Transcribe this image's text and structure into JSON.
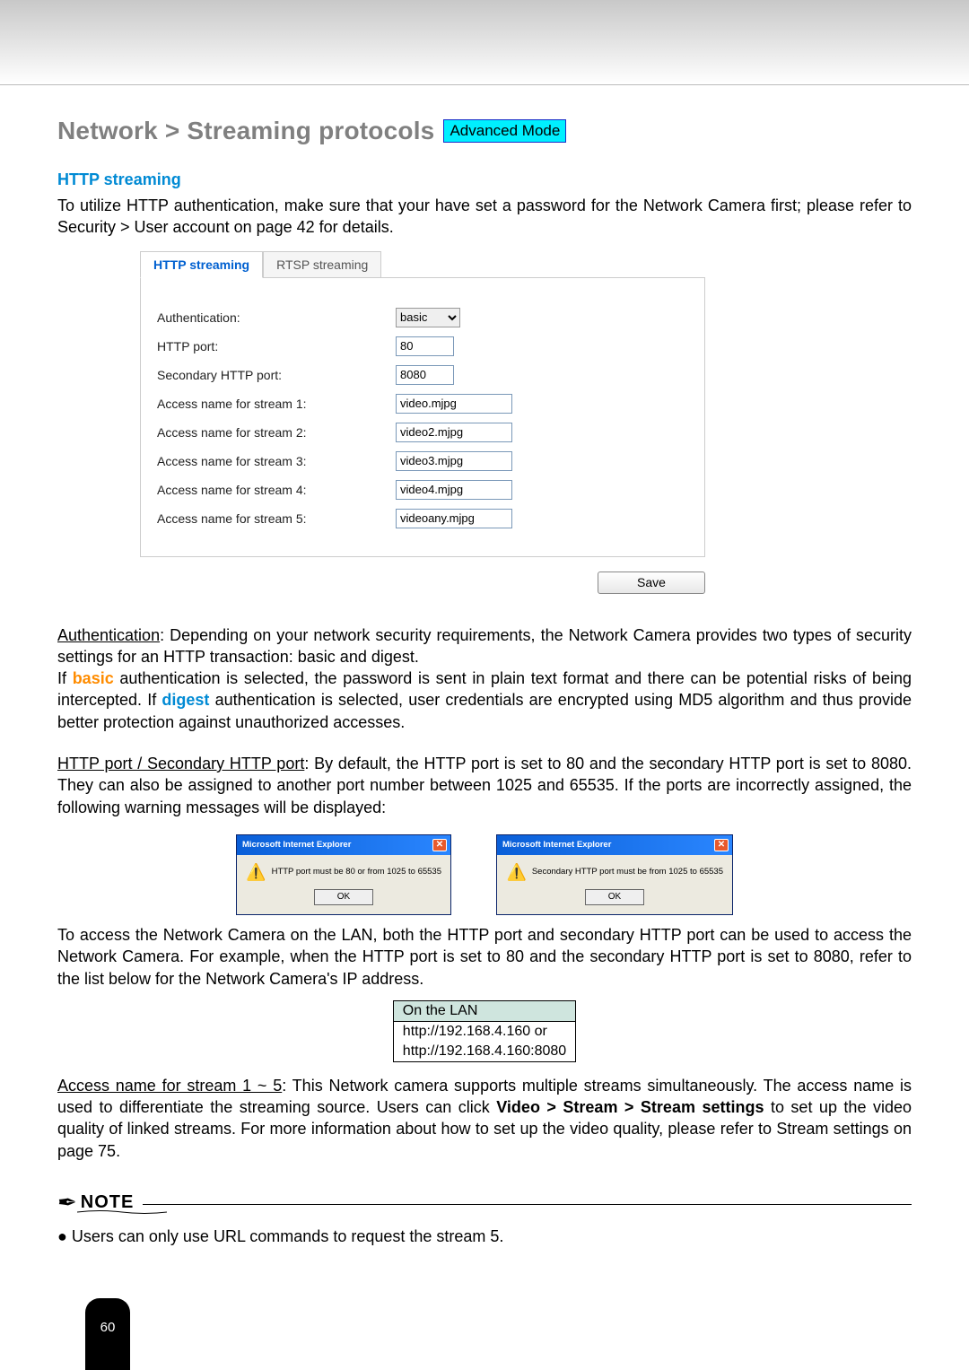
{
  "page_number": "60",
  "heading": {
    "breadcrumb": "Network > Streaming protocols",
    "badge": "Advanced Mode"
  },
  "section_title": "HTTP streaming",
  "intro_text": "To utilize HTTP authentication, make sure that your have set a password for the Network Camera first; please refer to Security > User account on page 42 for details.",
  "tabs": {
    "http": "HTTP streaming",
    "rtsp": "RTSP streaming"
  },
  "form": {
    "auth_label": "Authentication:",
    "auth_value": "basic",
    "http_port_label": "HTTP port:",
    "http_port_value": "80",
    "sec_http_port_label": "Secondary HTTP port:",
    "sec_http_port_value": "8080",
    "s1_label": "Access name for stream 1:",
    "s1_value": "video.mjpg",
    "s2_label": "Access name for stream 2:",
    "s2_value": "video2.mjpg",
    "s3_label": "Access name for stream 3:",
    "s3_value": "video3.mjpg",
    "s4_label": "Access name for stream 4:",
    "s4_value": "video4.mjpg",
    "s5_label": "Access name for stream 5:",
    "s5_value": "videoany.mjpg",
    "save": "Save"
  },
  "para_auth_lead": "Authentication",
  "para_auth_rest": ": Depending on your network security requirements, the Network Camera provides two types of security settings for an HTTP transaction: basic and digest.",
  "para_basic_pre": "If ",
  "para_basic_word": "basic",
  "para_basic_mid": " authentication is selected, the password is sent in plain text format and there can be potential risks of being intercepted. If ",
  "para_digest_word": "digest",
  "para_basic_post": " authentication is selected, user credentials are encrypted using MD5 algorithm and thus provide better protection against unauthorized accesses.",
  "para_ports_lead": "HTTP port / Secondary HTTP port",
  "para_ports_rest": ": By default, the HTTP port is set to 80 and the secondary HTTP port is set to 8080. They can also be assigned to another port number between 1025 and 65535. If the ports are incorrectly assigned, the following warning messages will be displayed:",
  "dialog": {
    "title": "Microsoft Internet Explorer",
    "msg1": "HTTP port must be 80 or from 1025 to 65535",
    "msg2": "Secondary HTTP port must be from 1025 to 65535",
    "ok": "OK"
  },
  "para_lan": "To access the Network Camera on the LAN, both the HTTP port and secondary HTTP port can be used to access the Network Camera. For example, when the HTTP port is set to 80 and the secondary HTTP port is set to 8080, refer to the list below for the Network Camera's IP address.",
  "lan_table": {
    "header": "On the LAN",
    "row1": "http://192.168.4.160  or",
    "row2": "http://192.168.4.160:8080"
  },
  "para_access_lead": "Access name for stream 1 ~ 5",
  "para_access_rest_a": ": This Network camera supports multiple streams simultaneously. The access name is used to differentiate the streaming source. Users can click ",
  "para_access_bold": "Video > Stream > Stream settings",
  "para_access_rest_b": " to set up the video quality of linked streams. For more information about how to set up the video quality, please refer to Stream settings on page 75.",
  "note_label": "NOTE",
  "note_bullet": "● Users can only use URL commands to request the stream 5."
}
